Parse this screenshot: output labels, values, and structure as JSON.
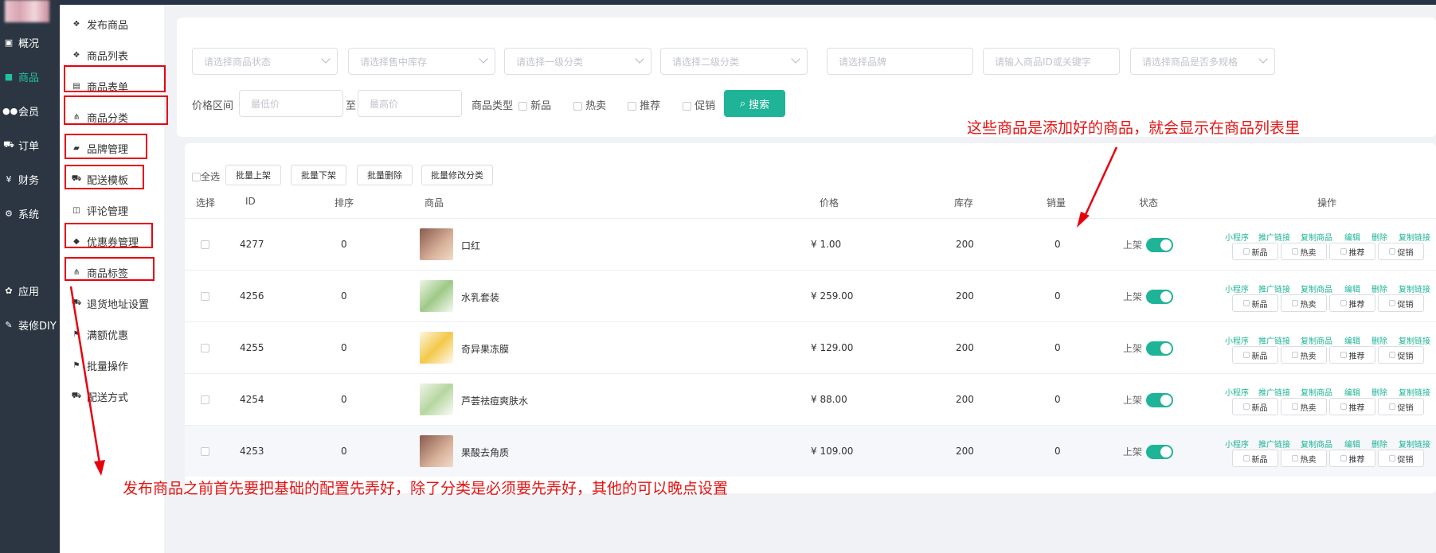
{
  "colors": {
    "sidebar": "#2b3642",
    "accent": "#1fb497",
    "annotation": "#e8000e"
  },
  "sidebar": {
    "items": [
      {
        "icon": "overview-icon",
        "label": "概况"
      },
      {
        "icon": "goods-icon",
        "label": "商品"
      },
      {
        "icon": "member-icon",
        "label": "会员"
      },
      {
        "icon": "order-icon",
        "label": "订单"
      },
      {
        "icon": "finance-icon",
        "label": "财务"
      },
      {
        "icon": "system-icon",
        "label": "系统"
      },
      {
        "icon": "app-icon",
        "label": "应用"
      },
      {
        "icon": "diy-icon",
        "label": "装修DIY"
      }
    ]
  },
  "subnav": {
    "items": [
      {
        "icon": "cubes-icon",
        "label": "发布商品"
      },
      {
        "icon": "cubes-icon",
        "label": "商品列表"
      },
      {
        "icon": "form-icon",
        "label": "商品表单"
      },
      {
        "icon": "sitemap-icon",
        "label": "商品分类"
      },
      {
        "icon": "briefcase-icon",
        "label": "品牌管理"
      },
      {
        "icon": "truck-icon",
        "label": "配送模板"
      },
      {
        "icon": "comment-icon",
        "label": "评论管理"
      },
      {
        "icon": "tag-icon",
        "label": "优惠券管理"
      },
      {
        "icon": "sitemap-icon",
        "label": "商品标签"
      },
      {
        "icon": "truck-icon",
        "label": "退货地址设置"
      },
      {
        "icon": "gift-icon",
        "label": "满额优惠"
      },
      {
        "icon": "gift-icon",
        "label": "批量操作"
      },
      {
        "icon": "truck-icon",
        "label": "配送方式"
      }
    ]
  },
  "filters": {
    "status_placeholder": "请选择商品状态",
    "stock_placeholder": "请选择售中库存",
    "cat1_placeholder": "请选择一级分类",
    "cat2_placeholder": "请选择二级分类",
    "brand_placeholder": "请选择品牌",
    "keyword_placeholder": "请输入商品ID或关键字",
    "spec_placeholder": "请选择商品是否多规格",
    "price_label": "价格区间",
    "min_placeholder": "最低价",
    "to_label": "至",
    "max_placeholder": "最高价",
    "type_label": "商品类型",
    "types": [
      "新品",
      "热卖",
      "推荐",
      "促销"
    ],
    "search_label": "搜索"
  },
  "toolbar": {
    "select_all": "全选",
    "batch_buttons": [
      "批量上架",
      "批量下架",
      "批量删除",
      "批量修改分类"
    ]
  },
  "table": {
    "headers": {
      "select": "选择",
      "id": "ID",
      "sort": "排序",
      "goods": "商品",
      "price": "价格",
      "stock": "库存",
      "sales": "销量",
      "status": "状态",
      "ops": "操作"
    },
    "op_links": [
      "小程序",
      "推广链接",
      "复制商品",
      "编辑",
      "删除",
      "复制链接"
    ],
    "tag_buttons": [
      "新品",
      "热卖",
      "推荐",
      "促销"
    ],
    "rows": [
      {
        "id": "4277",
        "sort": "0",
        "name": "口红",
        "price": "¥ 1.00",
        "stock": "200",
        "sales": "0",
        "status": "上架",
        "status_on": true
      },
      {
        "id": "4256",
        "sort": "0",
        "name": "水乳套装",
        "price": "¥ 259.00",
        "stock": "200",
        "sales": "0",
        "status": "上架",
        "status_on": true
      },
      {
        "id": "4255",
        "sort": "0",
        "name": "奇异果冻膜",
        "price": "¥ 129.00",
        "stock": "200",
        "sales": "0",
        "status": "上架",
        "status_on": true
      },
      {
        "id": "4254",
        "sort": "0",
        "name": "芦荟祛痘爽肤水",
        "price": "¥ 88.00",
        "stock": "200",
        "sales": "0",
        "status": "上架",
        "status_on": true
      },
      {
        "id": "4253",
        "sort": "0",
        "name": "果酸去角质",
        "price": "¥ 109.00",
        "stock": "200",
        "sales": "0",
        "status": "上架",
        "status_on": true
      }
    ]
  },
  "annotations": {
    "top_note": "这些商品是添加好的商品，就会显示在商品列表里",
    "bottom_note": "发布商品之前首先要把基础的配置先弄好，除了分类是必须要先弄好，其他的可以晚点设置"
  }
}
